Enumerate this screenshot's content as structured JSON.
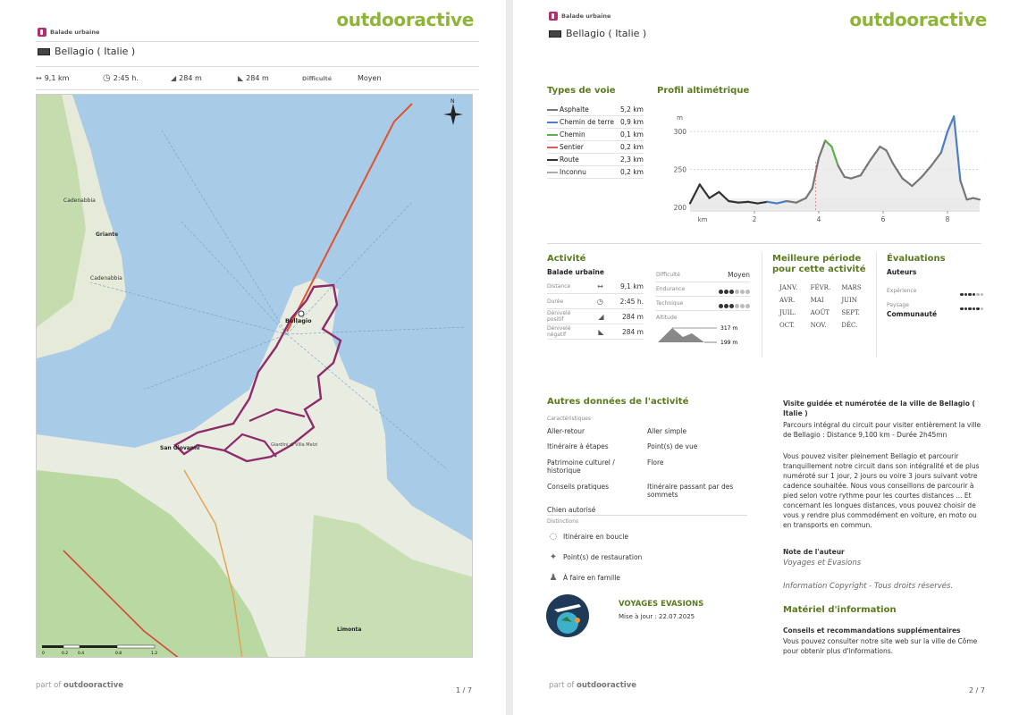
{
  "brand": "outdooractive",
  "category": "Balade urbaine",
  "title": "Bellagio ( Italie )",
  "footer_prefix": "part of",
  "footer_brand": "outdooractive",
  "page1": {
    "stats": {
      "distance": "9,1 km",
      "duration": "2:45 h.",
      "ascent": "284 m",
      "descent": "284 m",
      "difficulty_label": "Difficulté",
      "difficulty": "Moyen"
    },
    "page_number": "1 / 7",
    "map_labels": {
      "cadenabbia": "Cadenabbia",
      "griante": "Griante",
      "cadenabbia_lower": "Cadenabbia",
      "bellagio": "Bellagio",
      "san_giovanni": "San Giovanni",
      "limonta": "Limonta",
      "villa": "Giardini di Villa Melzi",
      "scale": [
        "0",
        "0.2",
        "0.4",
        "0.8",
        "1.2"
      ]
    },
    "colors": {
      "route": "#8e2b6a",
      "lake": "#a8cbe8",
      "land": "#e9ede1",
      "forest": "#a6cf8e",
      "ferry": "#e0532d"
    }
  },
  "page2": {
    "page_number": "2 / 7",
    "types_title": "Types de voie",
    "types": [
      {
        "name": "Asphalte",
        "value": "5,2 km",
        "color": "#777777"
      },
      {
        "name": "Chemin de terre",
        "value": "0,9 km",
        "color": "#4a7ec9"
      },
      {
        "name": "Chemin",
        "value": "0,1 km",
        "color": "#5ab04a"
      },
      {
        "name": "Sentier",
        "value": "0,2 km",
        "color": "#e25a5a"
      },
      {
        "name": "Route",
        "value": "2,3 km",
        "color": "#333333"
      },
      {
        "name": "Inconnu",
        "value": "0,2 km",
        "color": "#aaaaaa"
      }
    ],
    "profile_title": "Profil altimétrique",
    "chart_data": {
      "type": "line",
      "title": "Profil altimétrique",
      "ylabel": "m",
      "xlabel": "km",
      "ylim": [
        195,
        325
      ],
      "xlim": [
        0,
        9
      ],
      "yticks": [
        200,
        250,
        300
      ],
      "xticks": [
        2,
        4,
        6,
        8
      ],
      "x": [
        0,
        0.3,
        0.6,
        0.9,
        1.2,
        1.5,
        1.8,
        2.1,
        2.4,
        2.7,
        3.0,
        3.3,
        3.6,
        3.8,
        4.0,
        4.2,
        4.4,
        4.6,
        4.8,
        5.0,
        5.3,
        5.6,
        5.9,
        6.1,
        6.3,
        6.6,
        6.9,
        7.2,
        7.5,
        7.8,
        8.0,
        8.2,
        8.4,
        8.6,
        8.8,
        9.0
      ],
      "y": [
        205,
        230,
        212,
        220,
        208,
        206,
        207,
        205,
        207,
        205,
        208,
        206,
        212,
        225,
        265,
        288,
        280,
        255,
        240,
        238,
        242,
        262,
        280,
        275,
        258,
        238,
        228,
        240,
        255,
        272,
        300,
        320,
        235,
        210,
        212,
        210
      ]
    },
    "activity_title": "Activité",
    "activity_type": "Balade urbaine",
    "activity_rows": [
      {
        "label": "Distance",
        "value": "9,1 km",
        "icon": "↔"
      },
      {
        "label": "Durée",
        "value": "2:45 h.",
        "icon": "◷"
      },
      {
        "label": "Dénivelé positif",
        "value": "284 m",
        "icon": "◢"
      },
      {
        "label": "Dénivelé négatif",
        "value": "284 m",
        "icon": "◣"
      }
    ],
    "difficulty_label": "Difficulté",
    "difficulty": "Moyen",
    "endurance_label": "Endurance",
    "endurance_level": 3,
    "technique_label": "Technique",
    "technique_level": 3,
    "altitude_label": "Altitude",
    "alt_max": "317 m",
    "alt_min": "199 m",
    "season_title": "Meilleure période pour cette activité",
    "months": [
      "JANV.",
      "FÉVR.",
      "MARS",
      "AVR.",
      "MAI",
      "JUIN",
      "JUIL.",
      "AOÛT",
      "SEPT.",
      "OCT.",
      "NOV.",
      "DÉC."
    ],
    "ratings_title": "Évaluations",
    "ratings_authors": "Auteurs",
    "experience_label": "Expérience",
    "experience_level": 4,
    "landscape_label": "Paysage",
    "landscape_level": 5,
    "community": "Communauté",
    "other_title": "Autres données de l'activité",
    "characteristics_label": "Caractéristiques",
    "characteristics": [
      "Aller-retour",
      "Aller simple",
      "Itinéraire à étapes",
      "Point(s) de vue",
      "Patrimoine culturel / historique",
      "Flore",
      "Conseils pratiques",
      "Itinéraire passant par des sommets",
      "Chien autorisé"
    ],
    "distinctions_label": "Distinctions",
    "distinctions": [
      {
        "icon": "loop-icon",
        "label": "Itinéraire en boucle"
      },
      {
        "icon": "restaurant-icon",
        "label": "Point(s) de restauration"
      },
      {
        "icon": "family-icon",
        "label": "À faire en famille"
      }
    ],
    "author_name": "VOYAGES EVASIONS",
    "updated": "Mise à jour : 22.07.2025",
    "desc_title": "Visite guidée et numérotée de la ville de Bellagio ( Italie )",
    "desc_1": "Parcours intégral du circuit pour visiter entièrement la ville de Bellagio : Distance 9,100 km - Durée 2h45mn",
    "desc_2": "Vous pouvez visiter pleinement Bellagio et parcourir tranquillement notre circuit dans son intégralité et de plus numéroté sur 1 jour, 2 jours ou voire 3 jours suivant votre cadence souhaitée. Nous vous conseillons de parcourir à pied selon votre rythme pour les courtes distances ... Et concernant les longues distances, vous pouvez choisir de vous y rendre plus commodément en voiture, en moto ou en transports en commun.",
    "author_note_label": "Note de l'auteur",
    "author_note": "Voyages et Evasions",
    "copyright": "Information Copyright - Tous droits réservés.",
    "material_title": "Matériel d'information",
    "tips_title": "Conseils et recommandations supplémentaires",
    "tips": "Vous pouvez consulter notre site web sur la ville de Côme pour obtenir plus d'informations."
  }
}
